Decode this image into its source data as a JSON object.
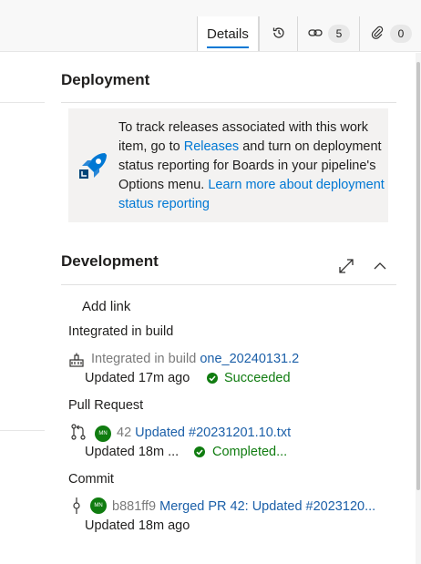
{
  "tabs": {
    "details_label": "Details",
    "links_count": "5",
    "attachments_count": "0"
  },
  "deployment": {
    "title": "Deployment",
    "info_text_1": "To track releases associated with this work item, go to ",
    "releases_link": "Releases",
    "info_text_2": " and turn on deployment status reporting for Boards in your pipeline's Options menu. ",
    "learn_more_link": "Learn more about deployment status reporting"
  },
  "development": {
    "title": "Development",
    "add_link_label": "Add link",
    "groups": [
      {
        "header": "Integrated in build",
        "prefix": "Integrated in build",
        "link": "one_20240131.2",
        "updated": "Updated 17m ago",
        "status": "Succeeded"
      },
      {
        "header": "Pull Request",
        "avatar": "MN",
        "prefix": "42",
        "link": "Updated #20231201.10.txt",
        "updated": "Updated 18m ...",
        "status": "Completed..."
      },
      {
        "header": "Commit",
        "avatar": "MN",
        "prefix": "b881ff9",
        "link": "Merged PR 42: Updated #2023120...",
        "updated": "Updated 18m ago"
      }
    ]
  },
  "colors": {
    "accent": "#0078d4",
    "success": "#107c10",
    "link": "#1b5fa8"
  }
}
